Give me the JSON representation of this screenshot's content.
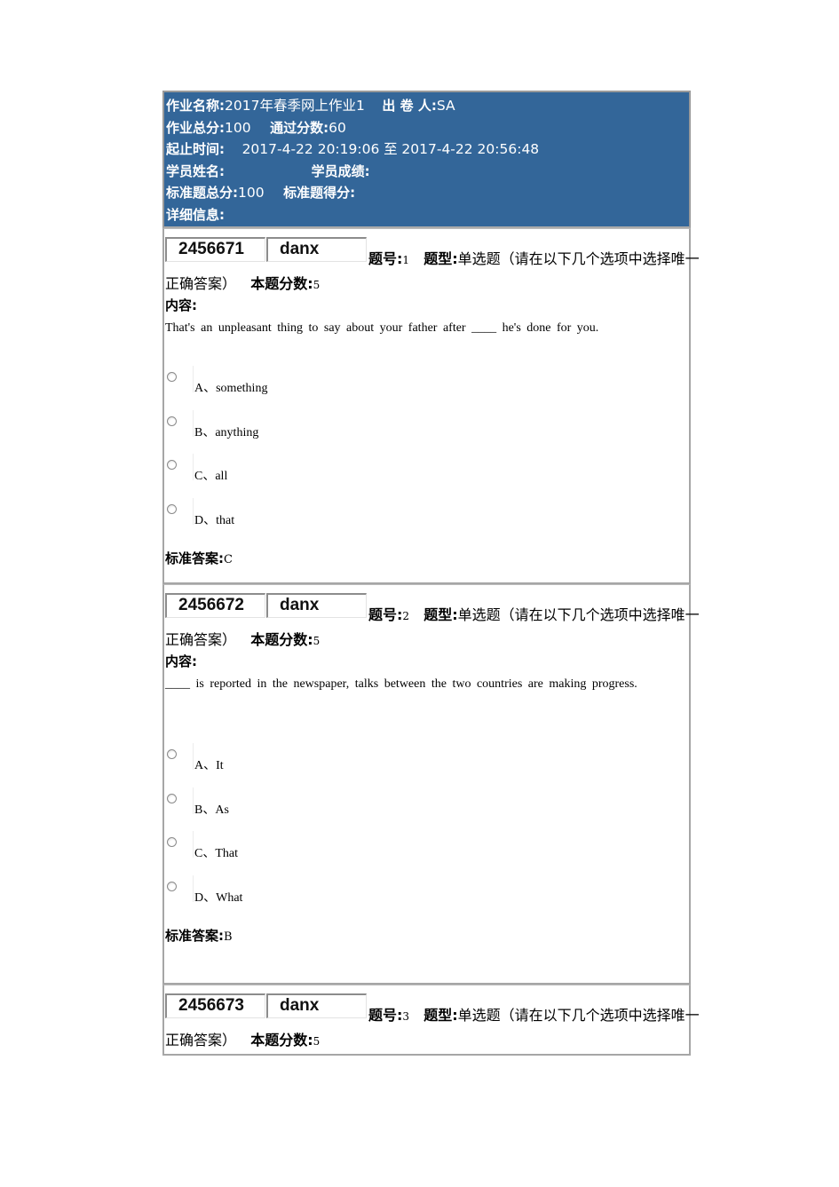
{
  "header": {
    "assignment_name_label": "作业名称:",
    "assignment_name": "2017年春季网上作业1",
    "author_label": "出 卷 人:",
    "author": "SA",
    "total_score_label": "作业总分:",
    "total_score": "100",
    "pass_score_label": "通过分数:",
    "pass_score": "60",
    "time_label": "起止时间:",
    "start_time": "2017-4-22 20:19:06",
    "time_separator": "至",
    "end_time": "2017-4-22 20:56:48",
    "student_name_label": "学员姓名:",
    "student_name": "",
    "student_score_label": "学员成绩:",
    "student_score": "",
    "std_total_label": "标准题总分:",
    "std_total": "100",
    "std_got_label": "标准题得分:",
    "std_got": "",
    "detail_label": "详细信息:"
  },
  "labels": {
    "number": "题号:",
    "type": "题型:",
    "score": "本题分数:",
    "content": "内容:",
    "answer": "标准答案:"
  },
  "questions": [
    {
      "id": "2456671",
      "code": "danx",
      "number": "1",
      "type_line1": "单选题（请在以下几个选项中选择唯一",
      "type_line2": "正确答案）",
      "score": "5",
      "content": "That's an unpleasant thing to say about your father after ____ he's done for you.",
      "options": [
        "A、something",
        "B、anything",
        "C、all",
        "D、that"
      ],
      "answer": "C"
    },
    {
      "id": "2456672",
      "code": "danx",
      "number": "2",
      "type_line1": "单选题（请在以下几个选项中选择唯一",
      "type_line2": "正确答案）",
      "score": "5",
      "content": "____ is reported in the newspaper, talks between the two countries are making progress.",
      "options": [
        "A、It",
        "B、As",
        "C、That",
        "D、What"
      ],
      "answer": "B"
    },
    {
      "id": "2456673",
      "code": "danx",
      "number": "3",
      "type_line1": "单选题（请在以下几个选项中选择唯一",
      "type_line2": "正确答案）",
      "score": "5"
    }
  ]
}
